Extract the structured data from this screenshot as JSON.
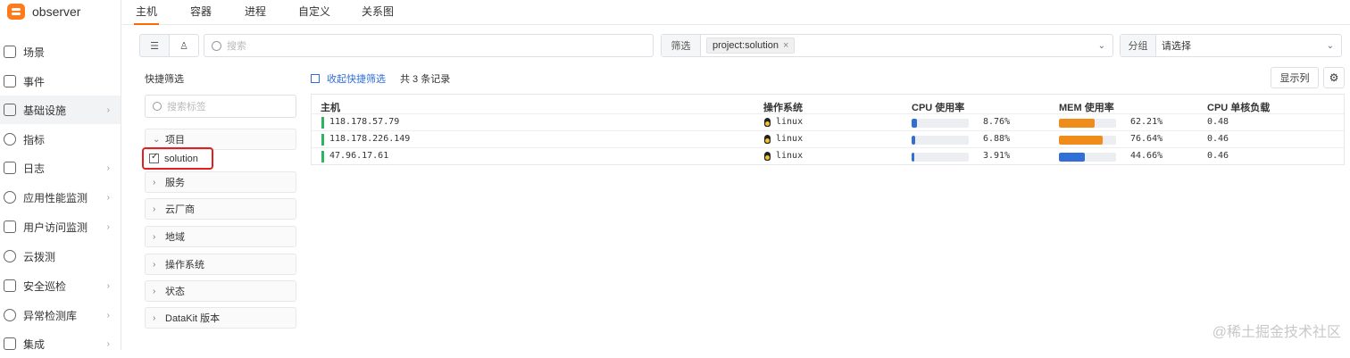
{
  "app": {
    "name": "observer"
  },
  "sidebar": {
    "items": [
      {
        "label": "场景",
        "has_arrow": false,
        "icon": "monitor-icon"
      },
      {
        "label": "事件",
        "has_arrow": false,
        "icon": "flag-icon"
      },
      {
        "label": "基础设施",
        "has_arrow": true,
        "icon": "grid-icon",
        "active": true
      },
      {
        "label": "指标",
        "has_arrow": false,
        "icon": "target-icon"
      },
      {
        "label": "日志",
        "has_arrow": true,
        "icon": "log-icon"
      },
      {
        "label": "应用性能监测",
        "has_arrow": true,
        "icon": "apm-icon"
      },
      {
        "label": "用户访问监测",
        "has_arrow": true,
        "icon": "user-monitor-icon"
      },
      {
        "label": "云拨测",
        "has_arrow": false,
        "icon": "radio-icon"
      },
      {
        "label": "安全巡检",
        "has_arrow": true,
        "icon": "shield-icon"
      },
      {
        "label": "异常检测库",
        "has_arrow": true,
        "icon": "alert-icon"
      },
      {
        "label": "集成",
        "has_arrow": true,
        "icon": "integration-icon"
      }
    ],
    "arrow_glyph": "›"
  },
  "tabs": [
    "主机",
    "容器",
    "进程",
    "自定义",
    "关系图"
  ],
  "toolbar": {
    "search_placeholder": "搜索",
    "filter_label": "筛选",
    "filter_tag": "project:solution",
    "filter_tag_close": "×",
    "group_label": "分组",
    "group_value": "请选择",
    "view_list_icon": "☰",
    "view_grid_icon": "♙",
    "caret": "⌄"
  },
  "quick_filter": {
    "title": "快捷筛选",
    "search_placeholder": "搜索标签",
    "groups": [
      {
        "label": "项目",
        "expanded": true
      },
      {
        "label": "服务",
        "expanded": false
      },
      {
        "label": "云厂商",
        "expanded": false
      },
      {
        "label": "地域",
        "expanded": false
      },
      {
        "label": "操作系统",
        "expanded": false
      },
      {
        "label": "状态",
        "expanded": false
      },
      {
        "label": "DataKit 版本",
        "expanded": false
      }
    ],
    "selected_option": "solution",
    "chev_open": "⌄",
    "chev_closed": "›"
  },
  "table_toolbar": {
    "collapse_label": "收起快捷筛选",
    "record_count": "共 3 条记录",
    "show_columns": "显示列",
    "settings_icon": "⚙"
  },
  "table": {
    "columns": [
      "主机",
      "操作系统",
      "CPU 使用率",
      "MEM 使用率",
      "CPU 单核负载"
    ],
    "rows": [
      {
        "host": "118.178.57.79",
        "os": "linux",
        "cpu": "8.76%",
        "cpu_value": 8.76,
        "mem": "62.21%",
        "mem_value": 62.21,
        "load": "0.48"
      },
      {
        "host": "118.178.226.149",
        "os": "linux",
        "cpu": "6.88%",
        "cpu_value": 6.88,
        "mem": "76.64%",
        "mem_value": 76.64,
        "load": "0.46"
      },
      {
        "host": "47.96.17.61",
        "os": "linux",
        "cpu": "3.91%",
        "cpu_value": 3.91,
        "mem": "44.66%",
        "mem_value": 44.66,
        "load": "0.46"
      }
    ]
  },
  "colors": {
    "accent": "#ff6a00",
    "cpu_bar": "#2f6fd6",
    "mem_bar_high": "#f08c1a",
    "mem_bar_low": "#2f6fd6",
    "status_ok": "#2db55d",
    "highlight_box": "#e02020"
  },
  "watermark": "@稀土掘金技术社区"
}
